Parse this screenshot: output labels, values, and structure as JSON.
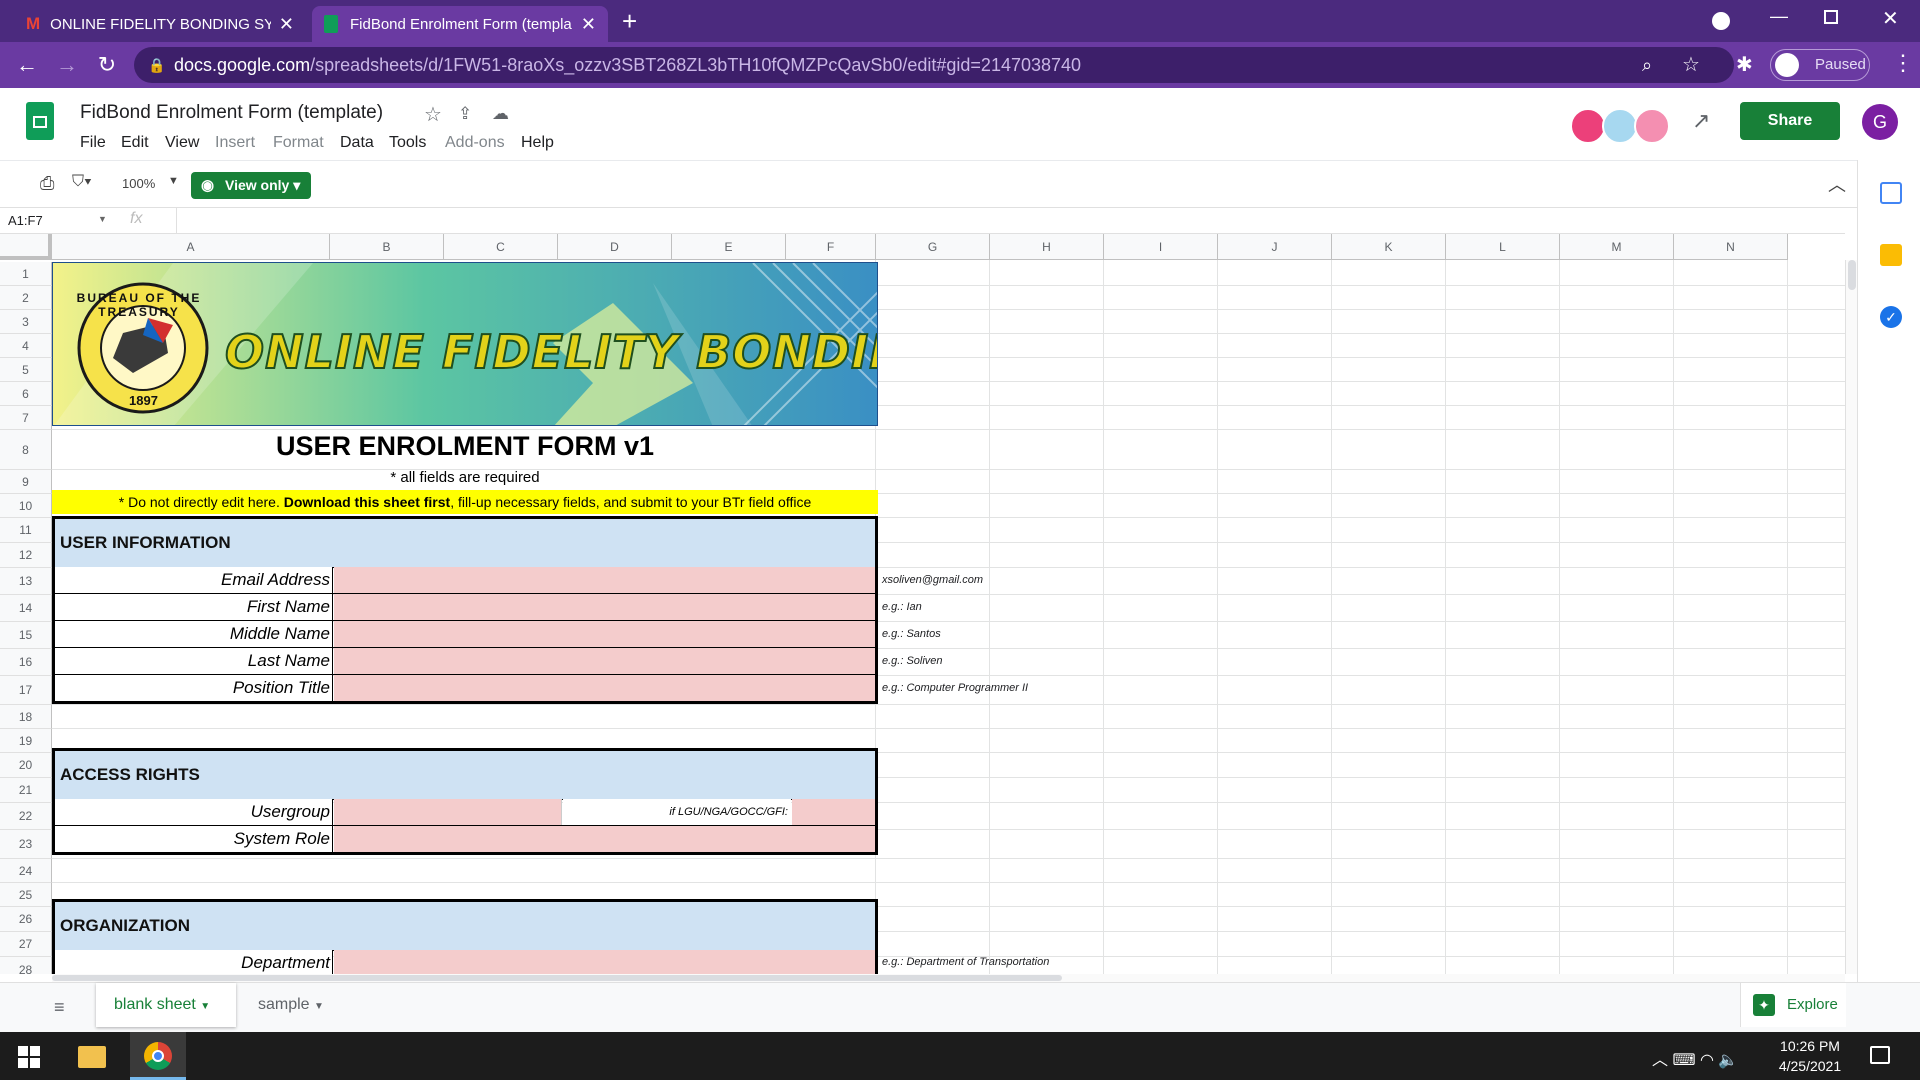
{
  "browser": {
    "tabs": [
      {
        "title": "ONLINE FIDELITY BONDING SYST",
        "icon": "gmail-icon"
      },
      {
        "title": "FidBond Enrolment Form (templa",
        "icon": "sheets-icon"
      }
    ],
    "url_domain": "docs.google.com",
    "url_path": "/spreadsheets/d/1FW51-8raoXs_ozzv3SBT268ZL3bTH10fQMZPcQavSb0/edit#gid=2147038740",
    "profile_status": "Paused"
  },
  "app": {
    "doc_title": "FidBond Enrolment Form (template)",
    "menus": [
      "File",
      "Edit",
      "View",
      "Insert",
      "Format",
      "Data",
      "Tools",
      "Add-ons",
      "Help"
    ],
    "share_label": "Share",
    "avatar_letter": "G"
  },
  "toolbar": {
    "zoom": "100%",
    "view_only_label": "View only"
  },
  "formula_bar": {
    "name_box": "A1:F7",
    "fx": "fx"
  },
  "grid": {
    "columns": [
      "A",
      "B",
      "C",
      "D",
      "E",
      "F",
      "G",
      "H",
      "I",
      "J",
      "K",
      "L",
      "M",
      "N"
    ],
    "rows": [
      "1",
      "2",
      "3",
      "4",
      "5",
      "6",
      "7",
      "8",
      "9",
      "10",
      "11",
      "12",
      "13",
      "14",
      "15",
      "16",
      "17",
      "18",
      "19",
      "20",
      "21",
      "22",
      "23",
      "24",
      "25",
      "26",
      "27",
      "28"
    ]
  },
  "form": {
    "banner_text": "ONLINE FIDELITY BONDING",
    "seal_text_top": "BUREAU OF THE TREASURY",
    "seal_year": "1897",
    "title": "USER ENROLMENT FORM v1",
    "required_note": "* all fields are required",
    "notice_pre": "* Do not directly edit here. ",
    "notice_bold": "Download this sheet first",
    "notice_post": ", fill-up necessary fields, and submit to your BTr field office",
    "section_user": "USER INFORMATION",
    "label_email": "Email Address",
    "label_first": "First Name",
    "label_middle": "Middle Name",
    "label_last": "Last Name",
    "label_position": "Position Title",
    "section_access": "ACCESS RIGHTS",
    "label_usergroup": "Usergroup",
    "usergroup_hint": "if LGU/NGA/GOCC/GFI:",
    "label_role": "System Role",
    "section_org": "ORGANIZATION",
    "label_department": "Department"
  },
  "hints": {
    "email": "xsoliven@gmail.com",
    "first": "e.g.: Ian",
    "middle": "e.g.: Santos",
    "last": "e.g.: Soliven",
    "position": "e.g.: Computer Programmer II",
    "department": "e.g.: Department of Transportation"
  },
  "sheets": {
    "tabs": [
      "blank sheet",
      "sample"
    ],
    "explore_label": "Explore"
  },
  "taskbar": {
    "time": "10:26 PM",
    "date": "4/25/2021"
  },
  "colors": {
    "browser_frame": "#4b2a7e",
    "sheets_green": "#188038",
    "section_blue": "#cfe2f3",
    "field_pink": "#f4cccc",
    "notice_yellow": "#ffff00"
  }
}
